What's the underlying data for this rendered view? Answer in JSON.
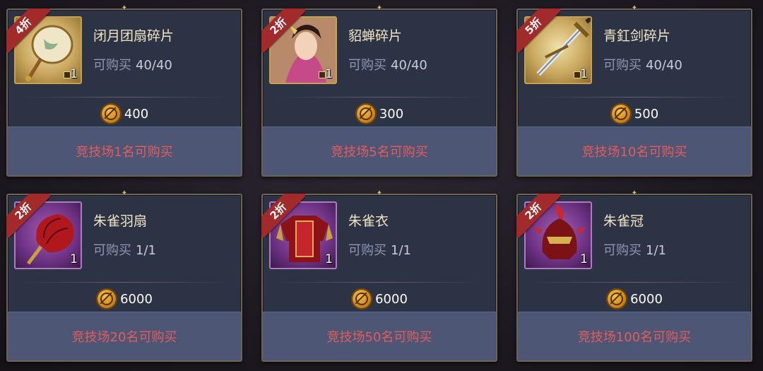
{
  "shop": {
    "items": [
      {
        "name": "闭月团扇碎片",
        "discount": "4折",
        "limit_label": "可购买",
        "limit": "40/40",
        "price": "400",
        "qty": "1",
        "requirement": "竞技场1名可购买",
        "icon": "fan-fragment-icon",
        "frame": "gold"
      },
      {
        "name": "貂蝉碎片",
        "discount": "2折",
        "limit_label": "可购买",
        "limit": "40/40",
        "price": "300",
        "qty": "1",
        "requirement": "竞技场5名可购买",
        "icon": "diaochan-portrait-icon",
        "frame": "gold"
      },
      {
        "name": "青釭剑碎片",
        "discount": "5折",
        "limit_label": "可购买",
        "limit": "40/40",
        "price": "500",
        "qty": "1",
        "requirement": "竞技场10名可购买",
        "icon": "sword-fragment-icon",
        "frame": "gold"
      },
      {
        "name": "朱雀羽扇",
        "discount": "2折",
        "limit_label": "可购买",
        "limit": "1/1",
        "price": "6000",
        "qty": "1",
        "requirement": "竞技场20名可购买",
        "icon": "feather-fan-icon",
        "frame": "purple"
      },
      {
        "name": "朱雀衣",
        "discount": "2折",
        "limit_label": "可购买",
        "limit": "1/1",
        "price": "6000",
        "qty": "1",
        "requirement": "竞技场50名可购买",
        "icon": "armor-icon",
        "frame": "purple"
      },
      {
        "name": "朱雀冠",
        "discount": "2折",
        "limit_label": "可购买",
        "limit": "1/1",
        "price": "6000",
        "qty": "1",
        "requirement": "竞技场100名可购买",
        "icon": "helmet-icon",
        "frame": "purple"
      }
    ]
  },
  "colors": {
    "card_bg": "#2c3345",
    "ribbon": "#a32a2a",
    "requirement_text": "#e25c5c",
    "button_bg": "#4d5674"
  }
}
